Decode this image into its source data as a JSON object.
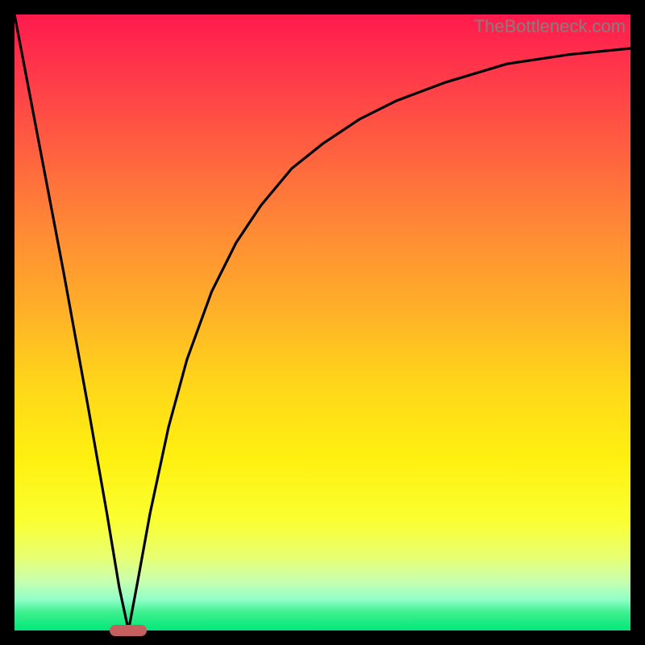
{
  "watermark": "TheBottleneck.com",
  "colors": {
    "frame": "#000000",
    "curve_stroke": "#000000",
    "marker": "#c66060",
    "watermark_text": "#808080"
  },
  "chart_data": {
    "type": "line",
    "title": "",
    "xlabel": "",
    "ylabel": "",
    "xlim": [
      0,
      100
    ],
    "ylim": [
      0,
      100
    ],
    "grid": false,
    "series": [
      {
        "name": "left-branch",
        "x": [
          0,
          4,
          8,
          12,
          15,
          17,
          18.5
        ],
        "y": [
          100,
          79,
          58,
          36,
          19,
          7,
          0
        ]
      },
      {
        "name": "right-branch",
        "x": [
          18.5,
          20,
          22,
          25,
          28,
          32,
          36,
          40,
          45,
          50,
          56,
          62,
          70,
          80,
          90,
          100
        ],
        "y": [
          0,
          8,
          19,
          33,
          44,
          55,
          63,
          69,
          75,
          79,
          83,
          86,
          89,
          92,
          93.5,
          94.5
        ]
      }
    ],
    "marker": {
      "x_center": 18.5,
      "width_pct": 6,
      "y": 0
    },
    "background_gradient": [
      {
        "stop": 0.0,
        "color": "#ff1a4d"
      },
      {
        "stop": 0.5,
        "color": "#ffd61a"
      },
      {
        "stop": 0.82,
        "color": "#fbff30"
      },
      {
        "stop": 1.0,
        "color": "#00e878"
      }
    ]
  }
}
